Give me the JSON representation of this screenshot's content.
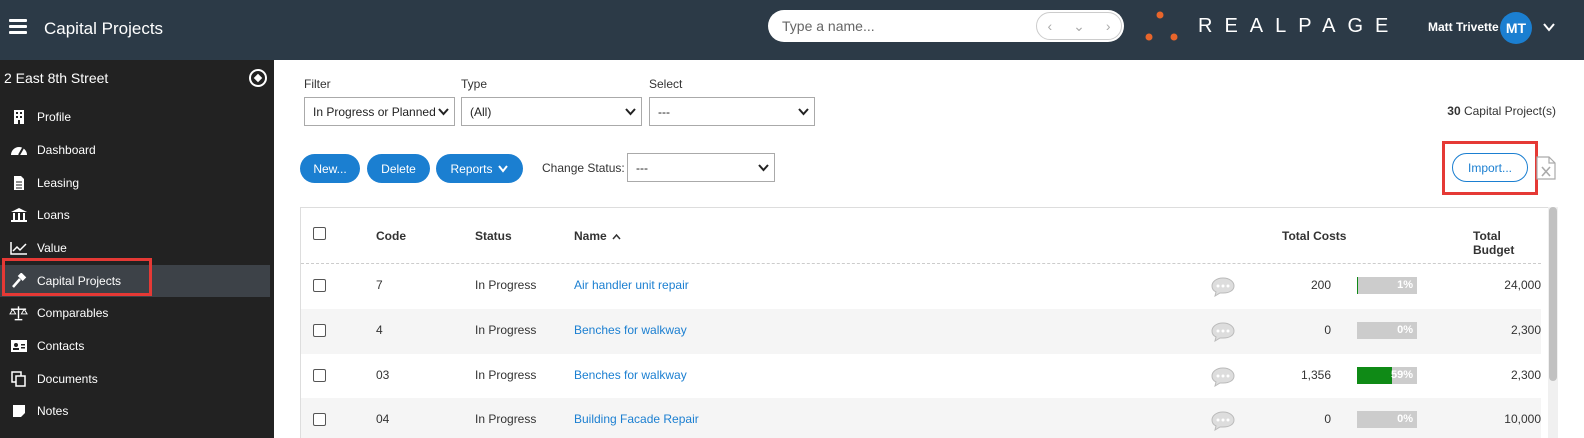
{
  "topbar": {
    "app_title": "Capital Projects",
    "search_placeholder": "Type a name...",
    "brand": "REALPAGE",
    "user_name": "Matt Trivette",
    "user_initials": "MT"
  },
  "sidebar": {
    "property_name": "2 East 8th Street",
    "items": [
      {
        "label": "Profile",
        "icon": "building-icon"
      },
      {
        "label": "Dashboard",
        "icon": "dashboard-icon"
      },
      {
        "label": "Leasing",
        "icon": "document-icon"
      },
      {
        "label": "Loans",
        "icon": "bank-icon"
      },
      {
        "label": "Value",
        "icon": "chart-line-icon"
      },
      {
        "label": "Capital Projects",
        "icon": "hammer-icon",
        "active": true
      },
      {
        "label": "Comparables",
        "icon": "scale-icon"
      },
      {
        "label": "Contacts",
        "icon": "contact-card-icon"
      },
      {
        "label": "Documents",
        "icon": "copy-icon"
      },
      {
        "label": "Notes",
        "icon": "note-icon"
      }
    ]
  },
  "filters": {
    "filter_label": "Filter",
    "filter_value": "In Progress or Planned",
    "type_label": "Type",
    "type_value": "(All)",
    "select_label": "Select",
    "select_value": "---",
    "count_number": "30",
    "count_text": "Capital Project(s)"
  },
  "toolbar": {
    "new_label": "New...",
    "delete_label": "Delete",
    "reports_label": "Reports",
    "change_status_label": "Change Status:",
    "change_status_value": "---",
    "import_label": "Import..."
  },
  "table": {
    "headers": {
      "code": "Code",
      "status": "Status",
      "name": "Name",
      "total_costs": "Total Costs",
      "total_budget": "Total Budget"
    },
    "rows": [
      {
        "code": "7",
        "status": "In Progress",
        "name": "Air handler unit repair",
        "total_costs": "200",
        "pct_label": "1%",
        "pct": 0.01,
        "total_budget": "24,000"
      },
      {
        "code": "4",
        "status": "In Progress",
        "name": "Benches for walkway",
        "total_costs": "0",
        "pct_label": "0%",
        "pct": 0,
        "total_budget": "2,300"
      },
      {
        "code": "03",
        "status": "In Progress",
        "name": "Benches for walkway",
        "total_costs": "1,356",
        "pct_label": "59%",
        "pct": 0.59,
        "total_budget": "2,300"
      },
      {
        "code": "04",
        "status": "In Progress",
        "name": "Building Facade Repair",
        "total_costs": "0",
        "pct_label": "0%",
        "pct": 0,
        "total_budget": "10,000"
      }
    ]
  },
  "colors": {
    "topbar": "#2c3a47",
    "sidebar": "#222222",
    "accent": "#1b7fd1",
    "progress_fill": "#0f8a16",
    "highlight": "#e53935",
    "brand_dots": "#e8652b"
  }
}
